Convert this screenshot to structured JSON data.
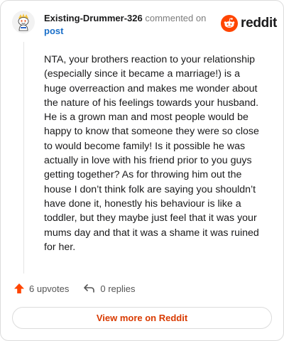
{
  "header": {
    "username": "Existing-Drummer-326",
    "commented_text": "commented on",
    "post_link": "post"
  },
  "brand": {
    "wordmark": "reddit",
    "accent_color": "#ff4500"
  },
  "comment": {
    "body": "NTA, your brothers reaction to your relationship (especially since it became a marriage!) is a huge overreaction and makes me wonder about the nature of his feelings towards your husband. He is a grown man and most people would be happy to know that someone they were so close to would become family! Is it possible he was actually in love with his friend prior to you guys getting together? As for throwing him out the house I don’t think folk are saying you shouldn’t have done it, honestly his behaviour is like a toddler, but they maybe just feel that it was your mums day and that it was a shame it was ruined for her."
  },
  "actions": {
    "upvotes": "6 upvotes",
    "replies": "0 replies"
  },
  "footer": {
    "view_more": "View more on Reddit"
  }
}
